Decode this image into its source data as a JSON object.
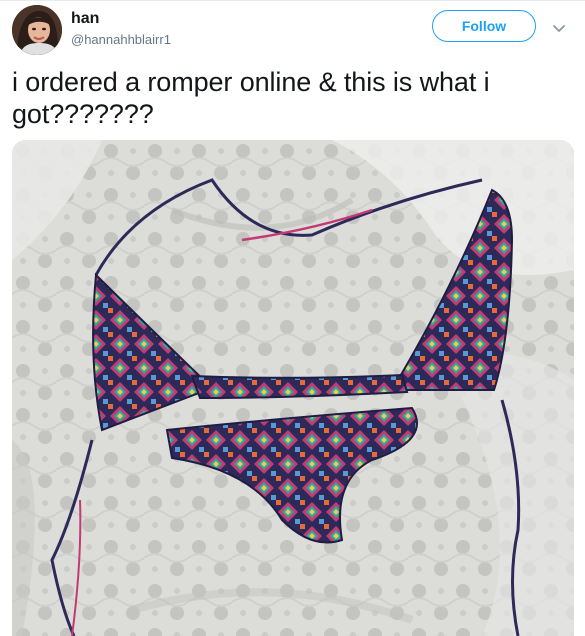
{
  "tweet": {
    "author": {
      "display_name": "han",
      "handle": "@hannahhblairr1",
      "avatar_icon": "profile-photo"
    },
    "follow_label": "Follow",
    "menu_icon": "chevron-down-icon",
    "text": "i ordered a romper online & this is what i got???????",
    "media": {
      "icon": "photo-of-patterned-bikini-on-bed"
    }
  },
  "colors": {
    "accent": "#1da1f2",
    "text": "#14171a",
    "secondary_text": "#657786",
    "border": "#e6ecf0"
  }
}
